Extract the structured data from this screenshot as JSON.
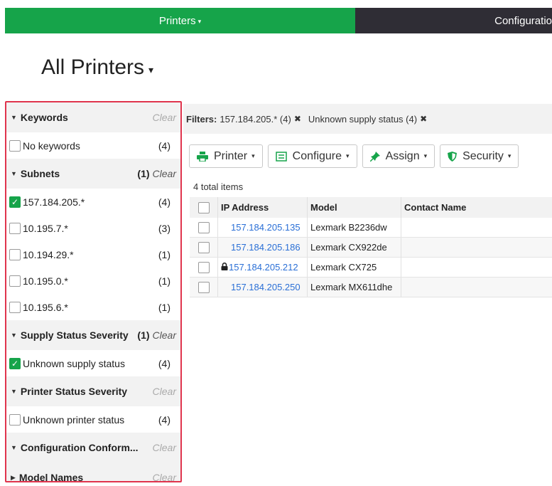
{
  "nav": {
    "printers": "Printers",
    "configurations": "Configuratio"
  },
  "page_title": "All Printers",
  "sidebar": {
    "keywords": {
      "title": "Keywords",
      "clear": "Clear",
      "items": [
        {
          "label": "No keywords",
          "count": "(4)",
          "checked": false
        }
      ]
    },
    "subnets": {
      "title": "Subnets",
      "count": "(1)",
      "clear": "Clear",
      "items": [
        {
          "label": "157.184.205.*",
          "count": "(4)",
          "checked": true
        },
        {
          "label": "10.195.7.*",
          "count": "(3)",
          "checked": false
        },
        {
          "label": "10.194.29.*",
          "count": "(1)",
          "checked": false
        },
        {
          "label": "10.195.0.*",
          "count": "(1)",
          "checked": false
        },
        {
          "label": "10.195.6.*",
          "count": "(1)",
          "checked": false
        }
      ]
    },
    "supply": {
      "title": "Supply Status Severity",
      "count": "(1)",
      "clear": "Clear",
      "items": [
        {
          "label": "Unknown supply status",
          "count": "(4)",
          "checked": true
        }
      ]
    },
    "printer_status": {
      "title": "Printer Status Severity",
      "clear": "Clear",
      "items": [
        {
          "label": "Unknown printer status",
          "count": "(4)",
          "checked": false
        }
      ]
    },
    "config_conformance": {
      "title": "Configuration Conform...",
      "clear": "Clear"
    },
    "model_names": {
      "title": "Model Names",
      "clear": "Clear"
    }
  },
  "filters": {
    "label": "Filters:",
    "chips": [
      "157.184.205.* (4)",
      "Unknown supply status (4)"
    ]
  },
  "toolbar": {
    "printer": "Printer",
    "configure": "Configure",
    "assign": "Assign",
    "security": "Security"
  },
  "total_items": "4 total items",
  "table": {
    "headers": {
      "ip": "IP Address",
      "model": "Model",
      "contact": "Contact Name"
    },
    "rows": [
      {
        "ip": "157.184.205.135",
        "model": "Lexmark B2236dw",
        "contact": "",
        "locked": false
      },
      {
        "ip": "157.184.205.186",
        "model": "Lexmark CX922de",
        "contact": "",
        "locked": false
      },
      {
        "ip": "157.184.205.212",
        "model": "Lexmark CX725",
        "contact": "",
        "locked": true
      },
      {
        "ip": "157.184.205.250",
        "model": "Lexmark MX611dhe",
        "contact": "",
        "locked": false
      }
    ]
  },
  "colors": {
    "accent": "#16a44a",
    "nav_dark": "#2f2d35",
    "link": "#2a6fd6",
    "highlight_border": "#e0344d"
  },
  "icons": {
    "printer": "printer-icon",
    "configure": "list-icon",
    "assign": "pin-icon",
    "security": "shield-icon",
    "lock": "lock-icon"
  }
}
